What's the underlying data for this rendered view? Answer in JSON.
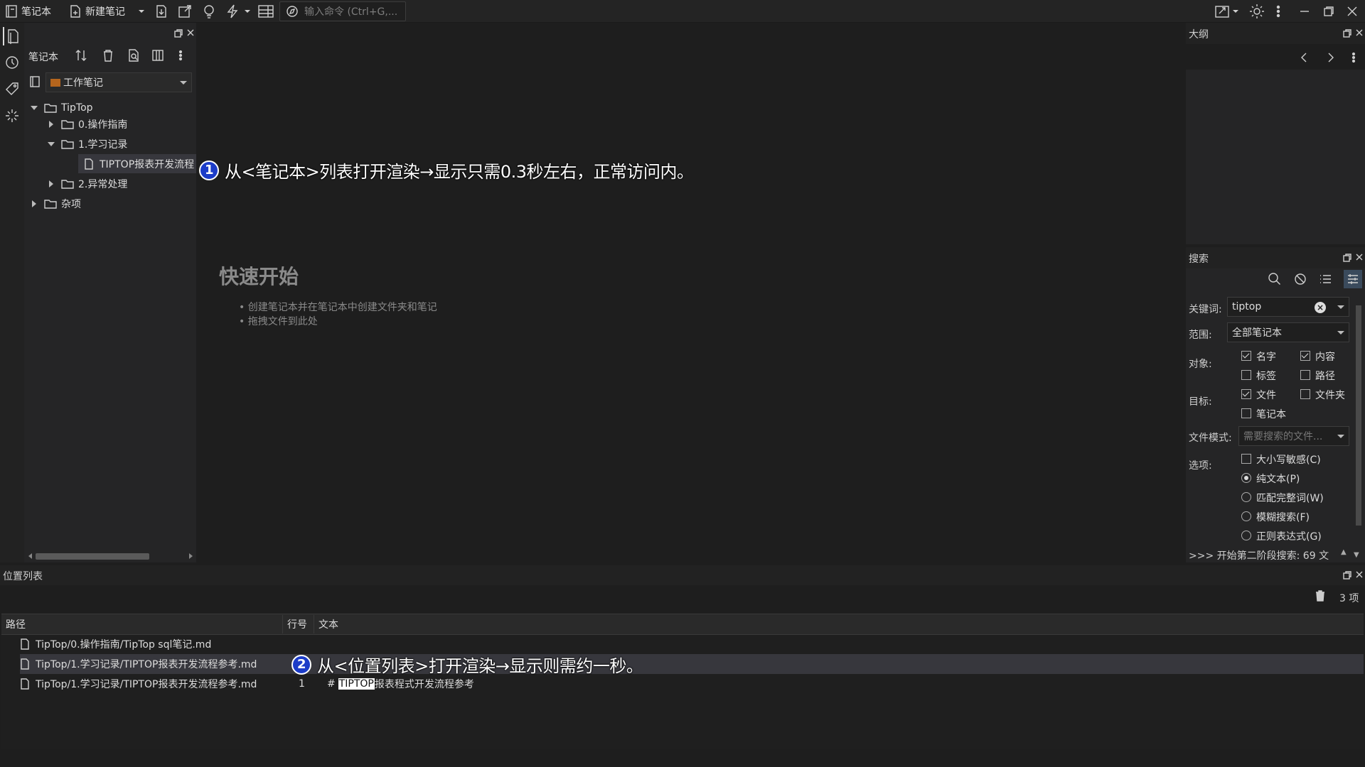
{
  "toolbar": {
    "notebook_label": "笔记本",
    "new_note_label": "新建笔记",
    "command_placeholder": "输入命令 (Ctrl+G,..."
  },
  "notebook_panel": {
    "tab_label": "笔记本",
    "selected_notebook": "工作笔记",
    "tree": [
      {
        "label": "TipTop",
        "expanded": true
      },
      {
        "label": "0.操作指南",
        "expanded": false
      },
      {
        "label": "1.学习记录",
        "expanded": true
      },
      {
        "label": "TIPTOP报表开发流程"
      },
      {
        "label": "2.异常处理",
        "expanded": false
      },
      {
        "label": "杂项",
        "expanded": false
      }
    ]
  },
  "editor": {
    "quick_start_title": "快速开始",
    "tips": [
      "创建笔记本并在笔记本中创建文件夹和笔记",
      "拖拽文件到此处"
    ]
  },
  "outline": {
    "title": "大纲"
  },
  "search": {
    "title": "搜索",
    "keyword_label": "关键词:",
    "keyword_value": "tiptop",
    "scope_label": "范围:",
    "scope_value": "全部笔记本",
    "object_label": "对象:",
    "objects": [
      {
        "label": "名字",
        "checked": true
      },
      {
        "label": "内容",
        "checked": true
      },
      {
        "label": "标签",
        "checked": false
      },
      {
        "label": "路径",
        "checked": false
      }
    ],
    "target_label": "目标:",
    "targets": [
      {
        "label": "文件",
        "checked": true
      },
      {
        "label": "文件夹",
        "checked": false
      },
      {
        "label": "笔记本",
        "checked": false
      }
    ],
    "file_pattern_label": "文件模式:",
    "file_pattern_placeholder": "需要搜索的文件...",
    "options_label": "选项:",
    "case_sensitive": "大小写敏感(C)",
    "modes": [
      {
        "label": "纯文本(P)",
        "selected": true
      },
      {
        "label": "匹配完整词(W)",
        "selected": false
      },
      {
        "label": "模糊搜索(F)",
        "selected": false
      },
      {
        "label": "正则表达式(G)",
        "selected": false
      }
    ],
    "status": ">>> 开始第二阶段搜索: 69 文"
  },
  "location_list": {
    "title": "位置列表",
    "count": "3 项",
    "columns": [
      "路径",
      "行号",
      "文本"
    ],
    "rows": [
      {
        "path": "TipTop/0.操作指南/TipTop sql笔记.md",
        "line": "",
        "prefix": "",
        "highlight": "",
        "text": ""
      },
      {
        "path": "TipTop/1.学习记录/TIPTOP报表开发流程参考.md",
        "line": "",
        "prefix": "",
        "highlight": "",
        "text": ""
      },
      {
        "path": "TipTop/1.学习记录/TIPTOP报表开发流程参考.md",
        "line": "1",
        "prefix": "#",
        "highlight": "TIPTOP",
        "text": "报表程式开发流程参考"
      }
    ]
  },
  "annotations": [
    {
      "num": "1",
      "text": "从<笔记本>列表打开渲染→显示只需0.3秒左右，正常访问内。"
    },
    {
      "num": "2",
      "text": "从<位置列表>打开渲染→显示则需约一秒。"
    }
  ],
  "colors": {
    "accent_badge": "#1c3cc8",
    "selected_row": "#37373d",
    "highlight_bg": "#ffffff"
  }
}
